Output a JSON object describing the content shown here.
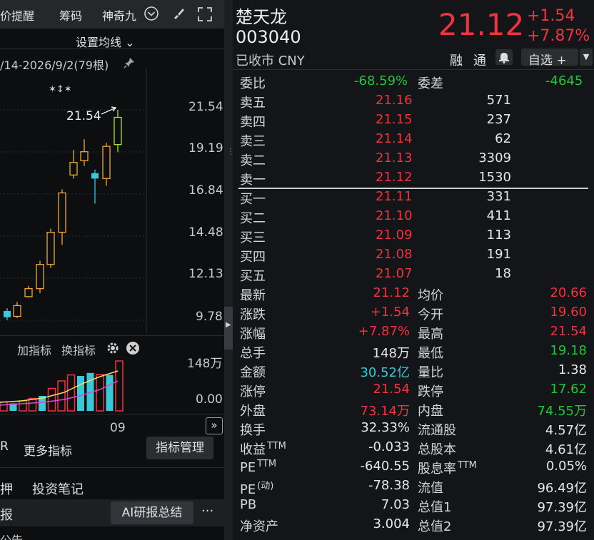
{
  "left": {
    "top_tabs": [
      "价提醒",
      "筹码",
      "神奇九"
    ],
    "ma_setting": "设置均线",
    "date_range": "/14-2026/9/2(79根)",
    "peak_label": "21.54",
    "y_ticks": [
      "21.54",
      "19.19",
      "16.84",
      "14.48",
      "12.13",
      "9.78"
    ],
    "indicator_bar": {
      "add": "加指标",
      "change": "换指标"
    },
    "vol_ticks": [
      "148万",
      "0.00"
    ],
    "x_label": "09",
    "bottom_buttons": {
      "r": "R",
      "more": "更多指标",
      "manage": "指标管理"
    },
    "tabs2": {
      "t1": "押",
      "t2": "投资笔记"
    },
    "bar3": {
      "t1": "报",
      "ai": "AI研报总结",
      "more": "···"
    },
    "bottom_text": "公告",
    "candles": [
      {
        "o": 10.3,
        "h": 10.45,
        "l": 9.8,
        "c": 9.95
      },
      {
        "o": 10.0,
        "h": 10.8,
        "l": 9.9,
        "c": 10.6
      },
      {
        "o": 11.1,
        "h": 11.7,
        "l": 11.05,
        "c": 11.55
      },
      {
        "o": 11.55,
        "h": 13.1,
        "l": 11.3,
        "c": 12.9
      },
      {
        "o": 12.9,
        "h": 14.9,
        "l": 12.7,
        "c": 14.7
      },
      {
        "o": 14.7,
        "h": 17.1,
        "l": 14.0,
        "c": 16.9
      },
      {
        "o": 17.9,
        "h": 19.3,
        "l": 17.7,
        "c": 18.6
      },
      {
        "o": 18.7,
        "h": 19.9,
        "l": 18.4,
        "c": 19.2
      },
      {
        "o": 18.0,
        "h": 18.2,
        "l": 16.3,
        "c": 17.7
      },
      {
        "o": 17.7,
        "h": 19.7,
        "l": 17.3,
        "c": 19.5
      },
      {
        "o": 19.6,
        "h": 21.54,
        "l": 19.18,
        "c": 21.12
      }
    ],
    "volumes": [
      0.18,
      0.15,
      0.2,
      0.25,
      0.3,
      0.45,
      0.6,
      0.72,
      0.7,
      0.76,
      0.73,
      0.72,
      1.0
    ],
    "vol_colors": [
      "#f0333d",
      "#38c8d8",
      "#f0333d",
      "#f0333d",
      "#38c8d8",
      "#f0333d",
      "#f0333d",
      "#f0333d",
      "#38c8d8",
      "#38c8d8",
      "#f0333d",
      "#38c8d8",
      "#f0333d"
    ]
  },
  "stock": {
    "name": "楚天龙",
    "code": "003040",
    "status": "已收市 CNY",
    "price": "21.12",
    "change": "+1.54",
    "change_pct": "+7.87%",
    "rong": "融",
    "tong": "通",
    "watch": "自选 +"
  },
  "orderbook": {
    "weibi_label": "委比",
    "weibi": "-68.59%",
    "weicha_label": "委差",
    "weicha": "-4645",
    "asks": [
      {
        "label": "卖五",
        "price": "21.16",
        "vol": "571"
      },
      {
        "label": "卖四",
        "price": "21.15",
        "vol": "237"
      },
      {
        "label": "卖三",
        "price": "21.14",
        "vol": "62"
      },
      {
        "label": "卖二",
        "price": "21.13",
        "vol": "3309"
      },
      {
        "label": "卖一",
        "price": "21.12",
        "vol": "1530"
      }
    ],
    "bids": [
      {
        "label": "买一",
        "price": "21.11",
        "vol": "331"
      },
      {
        "label": "买二",
        "price": "21.10",
        "vol": "411"
      },
      {
        "label": "买三",
        "price": "21.09",
        "vol": "113"
      },
      {
        "label": "买四",
        "price": "21.08",
        "vol": "191"
      },
      {
        "label": "买五",
        "price": "21.07",
        "vol": "18"
      }
    ]
  },
  "stats": [
    {
      "l1": "最新",
      "v1": "21.12",
      "c1": "red",
      "l2": "均价",
      "v2": "20.66",
      "c2": "red"
    },
    {
      "l1": "涨跌",
      "v1": "+1.54",
      "c1": "red",
      "l2": "今开",
      "v2": "19.60",
      "c2": "red"
    },
    {
      "l1": "涨幅",
      "v1": "+7.87%",
      "c1": "red",
      "l2": "最高",
      "v2": "21.54",
      "c2": "red"
    },
    {
      "l1": "总手",
      "v1": "148万",
      "c1": "white",
      "l2": "最低",
      "v2": "19.18",
      "c2": "green"
    },
    {
      "l1": "金额",
      "v1": "30.52亿",
      "c1": "cyan",
      "l2": "量比",
      "v2": "1.38",
      "c2": "white"
    },
    {
      "l1": "涨停",
      "v1": "21.54",
      "c1": "red",
      "l2": "跌停",
      "v2": "17.62",
      "c2": "green"
    },
    {
      "l1": "外盘",
      "v1": "73.14万",
      "c1": "red",
      "l2": "内盘",
      "v2": "74.55万",
      "c2": "green"
    },
    {
      "l1": "换手",
      "v1": "32.33%",
      "c1": "white",
      "l2": "流通股",
      "v2": "4.57亿",
      "c2": "white"
    },
    {
      "l1": "收益",
      "sup1": "TTM",
      "v1": "-0.033",
      "c1": "white",
      "l2": "总股本",
      "v2": "4.61亿",
      "c2": "white"
    },
    {
      "l1": "PE",
      "sup1": "TTM",
      "v1": "-640.55",
      "c1": "white",
      "l2": "股息率",
      "sup2": "TTM",
      "v2": "0.05%",
      "c2": "white"
    },
    {
      "l1": "PE",
      "sup1": "(动)",
      "v1": "-78.38",
      "c1": "white",
      "l2": "流值",
      "v2": "96.49亿",
      "c2": "white"
    },
    {
      "l1": "PB",
      "v1": "7.03",
      "c1": "white",
      "l2": "总值1",
      "v2": "97.39亿",
      "c2": "white"
    },
    {
      "l1": "净资产",
      "v1": "3.004",
      "c1": "white",
      "l2": "总值2",
      "v2": "97.39亿",
      "c2": "white"
    }
  ],
  "colors": {
    "up": "#f0333d",
    "down": "#38c8d8",
    "candle_up": "#f0a83a",
    "candle_last": "#a6e33b",
    "ma1": "#f0e060",
    "ma2": "#d64ad6"
  }
}
